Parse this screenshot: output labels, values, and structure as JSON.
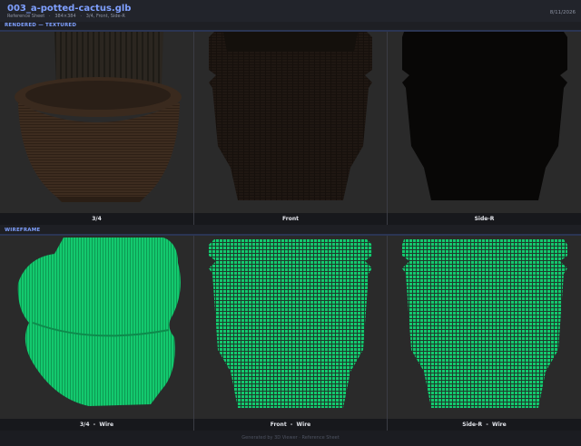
{
  "header": {
    "title": "003_a-potted-cactus.glb",
    "subtitle": "Reference Sheet   ·   384×384   ·   3/4, Front, Side-R",
    "date": "8/11/2026"
  },
  "sections": {
    "rendered_label": "RENDERED — TEXTURED",
    "wireframe_label": "WIREFRAME"
  },
  "rendered_views": [
    {
      "caption": "3/4"
    },
    {
      "caption": "Front"
    },
    {
      "caption": "Side-R"
    }
  ],
  "wire_views": [
    {
      "caption": "3/4  -  Wire"
    },
    {
      "caption": "Front  -  Wire"
    },
    {
      "caption": "Side-R  -  Wire"
    }
  ],
  "colors": {
    "accent": "#7fa0ff",
    "wire": "#13c96e",
    "panel_bg": "#2a2a2a"
  },
  "footer": {
    "text": "Generated by 3D Viewer · Reference Sheet"
  }
}
